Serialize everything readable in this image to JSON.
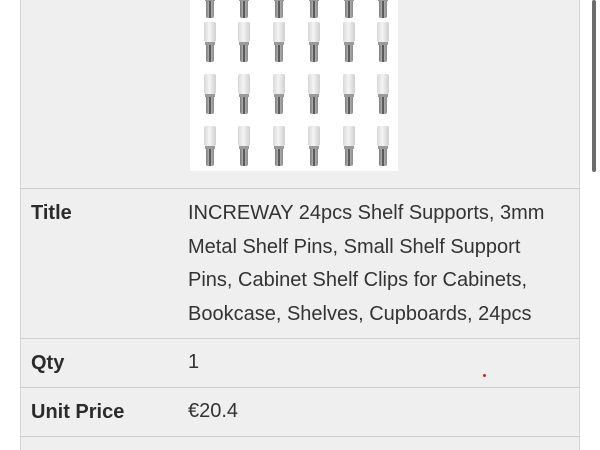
{
  "product": {
    "image_alt": "shelf-pins-product-photo",
    "pin_rows": 4,
    "pin_cols": 6
  },
  "details": {
    "title_label": "Title",
    "title_lines": [
      "INCREWAY 24pcs Shelf Supports, 3mm",
      "Metal Shelf Pins, Small Shelf Support",
      "Pins, Cabinet Shelf Clips for Cabinets,",
      "Bookcase, Shelves, Cupboards, 24pcs"
    ],
    "qty_label": "Qty",
    "qty_value": "1",
    "price_label": "Unit Price",
    "price_value": "€20.4"
  },
  "colors": {
    "table_bg": "#efefef",
    "border": "#cfcfcf",
    "accent_dot": "#e02020"
  }
}
